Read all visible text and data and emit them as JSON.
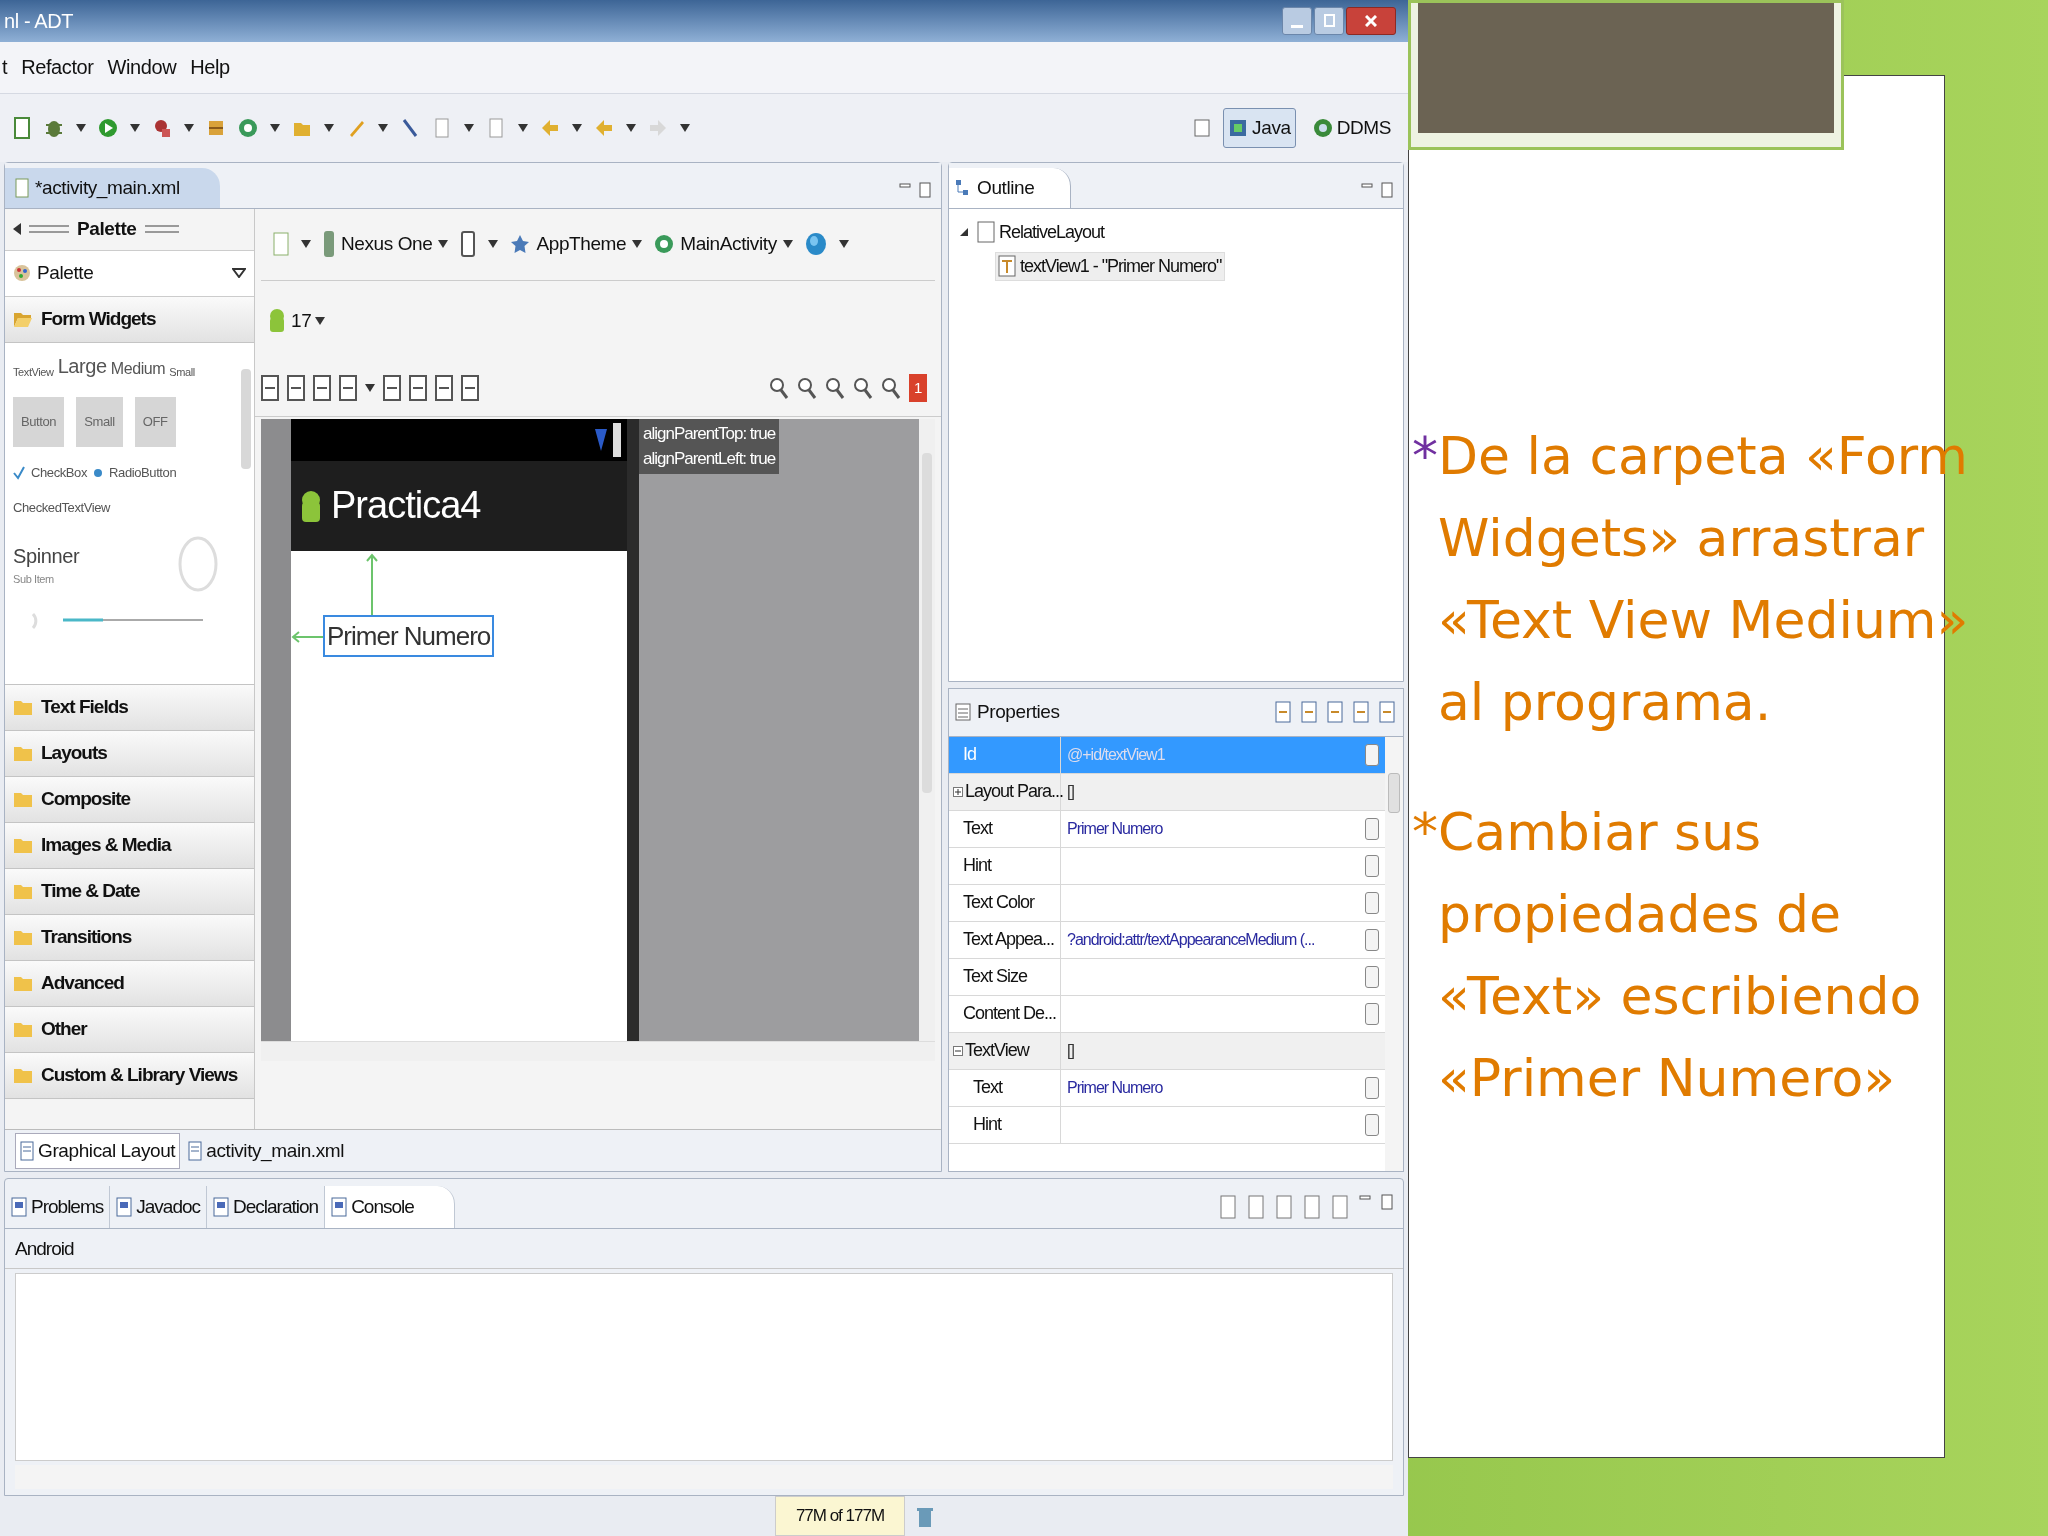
{
  "window": {
    "title": "nl - ADT"
  },
  "menu": [
    "t",
    "Refactor",
    "Window",
    "Help"
  ],
  "perspectives": [
    {
      "label": "Java",
      "selected": true
    },
    {
      "label": "DDMS",
      "selected": false
    }
  ],
  "editor": {
    "tab": "*activity_main.xml",
    "palette": {
      "header": "Palette",
      "dropdown": "Palette",
      "categories": [
        {
          "label": "Form Widgets",
          "expanded": true
        },
        {
          "label": "Text Fields",
          "expanded": false
        },
        {
          "label": "Layouts",
          "expanded": false
        },
        {
          "label": "Composite",
          "expanded": false
        },
        {
          "label": "Images & Media",
          "expanded": false
        },
        {
          "label": "Time & Date",
          "expanded": false
        },
        {
          "label": "Transitions",
          "expanded": false
        },
        {
          "label": "Advanced",
          "expanded": false
        },
        {
          "label": "Other",
          "expanded": false
        },
        {
          "label": "Custom & Library Views",
          "expanded": false
        }
      ],
      "widgets": {
        "text_sizes": [
          "TextView",
          "Large",
          "Medium",
          "Small"
        ],
        "buttons": [
          "Button",
          "Small",
          "OFF"
        ],
        "checkbox": "CheckBox",
        "radio": "RadioButton",
        "checked_text": "CheckedTextView",
        "spinner": "Spinner",
        "spinner_sub": "Sub Item"
      }
    },
    "toolbar": {
      "device": "Nexus One",
      "theme": "AppTheme",
      "activity": "MainActivity",
      "api": "17",
      "error_count": "1"
    },
    "preview": {
      "app_title": "Practica4",
      "widget_text": "Primer Numero",
      "tooltip": [
        "alignParentTop: true",
        "alignParentLeft: true"
      ]
    },
    "bottom_tabs": [
      {
        "label": "Graphical Layout",
        "selected": true
      },
      {
        "label": "activity_main.xml",
        "selected": false
      }
    ]
  },
  "outline": {
    "tab": "Outline",
    "tree": [
      {
        "label": "RelativeLayout",
        "expanded": true,
        "children": [
          {
            "label": "textView1 - \"Primer Numero\""
          }
        ]
      }
    ]
  },
  "properties": {
    "title": "Properties",
    "rows": [
      {
        "kind": "field",
        "name": "Id",
        "value": "@+id/textView1",
        "selected": true
      },
      {
        "kind": "group",
        "name": "Layout Para...",
        "value": "[]",
        "expanded": false,
        "selected": false
      },
      {
        "kind": "field",
        "name": "Text",
        "value": "Primer Numero",
        "selected": false
      },
      {
        "kind": "field",
        "name": "Hint",
        "selected": false
      },
      {
        "kind": "field",
        "name": "Text Color",
        "selected": false
      },
      {
        "kind": "field",
        "name": "Text Appea...",
        "value": "?android:attr/textAppearanceMedium (...",
        "selected": false
      },
      {
        "kind": "field",
        "name": "Text Size",
        "selected": false
      },
      {
        "kind": "field",
        "name": "Content De...",
        "selected": false
      },
      {
        "kind": "group",
        "name": "TextView",
        "value": "[]",
        "expanded": true,
        "selected": false,
        "children": [
          {
            "kind": "field",
            "name": "Text",
            "value": "Primer Numero",
            "selected": false
          },
          {
            "kind": "field",
            "name": "Hint",
            "selected": false
          }
        ]
      }
    ]
  },
  "console": {
    "tabs": [
      {
        "label": "Problems",
        "selected": false
      },
      {
        "label": "Javadoc",
        "selected": false
      },
      {
        "label": "Declaration",
        "selected": false
      },
      {
        "label": "Console",
        "selected": true
      }
    ],
    "title": "Android"
  },
  "status_bar": {
    "memory": "77M of 177M"
  },
  "slide": {
    "paragraphs": [
      {
        "marker": "*",
        "color": "#7030a0",
        "text": "De la carpeta «Form Widgets» arrastrar «Text View Medium» al programa."
      },
      {
        "marker": "*",
        "color": "#e07b00",
        "text": "Cambiar sus propiedades de «Text» escribiendo «Primer Numero»"
      }
    ]
  }
}
